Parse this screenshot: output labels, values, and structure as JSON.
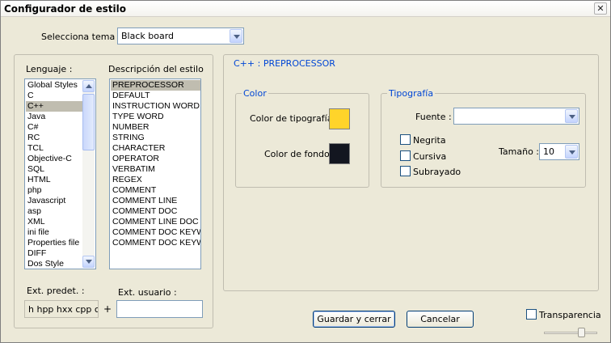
{
  "window": {
    "title": "Configurador de estilo",
    "close_glyph": "✕"
  },
  "theme": {
    "label": "Selecciona tema :",
    "value": "Black board"
  },
  "languages": {
    "label": "Lenguaje :",
    "items": [
      "Global Styles",
      "C",
      "C++",
      "Java",
      "C#",
      "RC",
      "TCL",
      "Objective-C",
      "SQL",
      "HTML",
      "php",
      "Javascript",
      "asp",
      "XML",
      "ini file",
      "Properties file",
      "DIFF",
      "Dos Style"
    ],
    "selected": "C++"
  },
  "styles": {
    "label": "Descripción del estilo",
    "items": [
      "PREPROCESSOR",
      "DEFAULT",
      "INSTRUCTION WORD",
      "TYPE WORD",
      "NUMBER",
      "STRING",
      "CHARACTER",
      "OPERATOR",
      "VERBATIM",
      "REGEX",
      "COMMENT",
      "COMMENT LINE",
      "COMMENT DOC",
      "COMMENT LINE DOC",
      "COMMENT DOC KEYWORD",
      "COMMENT DOC KEYWORD ERROR"
    ],
    "selected": "PREPROCESSOR"
  },
  "extensions": {
    "default_label": "Ext. predet. :",
    "default_value": "h hpp hxx cpp cxx cc",
    "plus": "+",
    "user_label": "Ext. usuario :",
    "user_value": ""
  },
  "detail": {
    "header": "C++ : PREPROCESSOR",
    "color_group": "Color",
    "fg_label": "Color de tipografía",
    "bg_label": "Color de fondo",
    "fg_color": "#ffd42a",
    "bg_color": "#131620",
    "typo_group": "Tipografía",
    "font_label": "Fuente :",
    "font_value": "",
    "bold": "Negrita",
    "italic": "Cursiva",
    "underline": "Subrayado",
    "size_label": "Tamaño :",
    "size_value": "10"
  },
  "actions": {
    "save": "Guardar y cerrar",
    "cancel": "Cancelar",
    "transparency": "Transparencia"
  }
}
